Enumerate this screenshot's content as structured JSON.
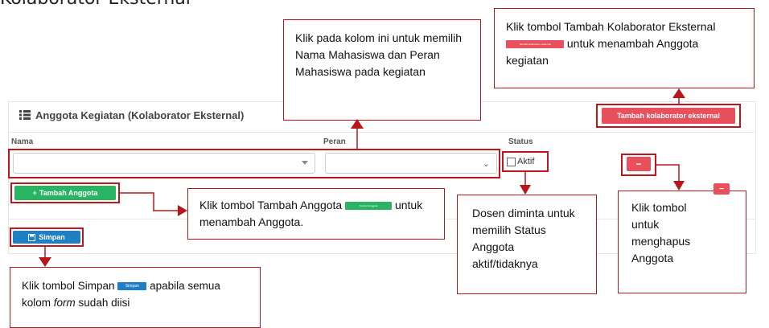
{
  "page_heading": "Kolaborator Eksternal",
  "panel": {
    "title": "Anggota Kegiatan (Kolaborator Eksternal)",
    "add_external_button": "Tambah kolaborator eksternal",
    "columns": [
      "Nama",
      "Peran",
      "Status"
    ],
    "status_checkbox_label": "Aktif",
    "add_member_button": "Tambah Anggota",
    "save_button": "Simpan"
  },
  "callouts": {
    "select_fields": "Klik pada kolom ini untuk memilih Nama Mahasiswa dan Peran Mahasiswa pada kegiatan",
    "add_external_pre": "Klik tombol Tambah Kolaborator Eksternal",
    "add_external_post": "untuk menambah Anggota kegiatan",
    "add_external_mini": "Tambah kolaborator eksternal",
    "add_member_pre": "Klik tombol  Tambah Anggota",
    "add_member_post": "untuk menambah Anggota.",
    "add_member_mini": "Tambah Anggota",
    "status": "Dosen diminta untuk memilih Status Anggota aktif/tidaknya",
    "delete": "Klik tombol untuk menghapus Anggota",
    "save_pre": "Klik tombol Simpan",
    "save_post": "apabila semua kolom",
    "save_em": "form",
    "save_tail": "sudah diisi",
    "save_mini": "Simpan"
  },
  "colors": {
    "danger": "#e8505b",
    "success": "#28b463",
    "primary": "#1f7fc4",
    "annotation": "#b8161b"
  }
}
